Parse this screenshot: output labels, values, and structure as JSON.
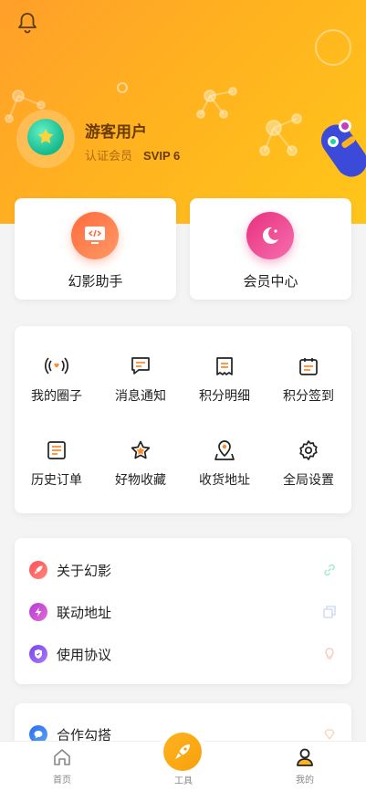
{
  "user": {
    "name": "游客用户",
    "level_label": "认证会员",
    "vip": "SVIP 6"
  },
  "quick_cards": [
    {
      "label": "幻影助手",
      "icon": "monitor-code-icon",
      "color": "#ff7a45"
    },
    {
      "label": "会员中心",
      "icon": "moon-icon",
      "color": "#ee3f8b"
    }
  ],
  "grid": [
    {
      "label": "我的圈子",
      "icon": "broadcast-heart-icon"
    },
    {
      "label": "消息通知",
      "icon": "message-icon"
    },
    {
      "label": "积分明细",
      "icon": "receipt-icon"
    },
    {
      "label": "积分签到",
      "icon": "calendar-icon"
    },
    {
      "label": "历史订单",
      "icon": "order-list-icon"
    },
    {
      "label": "好物收藏",
      "icon": "star-icon"
    },
    {
      "label": "收货地址",
      "icon": "map-pin-icon"
    },
    {
      "label": "全局设置",
      "icon": "gear-icon"
    }
  ],
  "links": [
    {
      "label": "关于幻影",
      "icon": "rocket-icon",
      "color": "#ff5a5f",
      "right_icon": "link-icon"
    },
    {
      "label": "联动地址",
      "icon": "lightning-icon",
      "color": "#c94bd6",
      "right_icon": "copy-icon"
    },
    {
      "label": "使用协议",
      "icon": "shield-icon",
      "color": "#8a52f2",
      "right_icon": "bulb-icon"
    }
  ],
  "partner": {
    "label": "合作勾搭",
    "icon": "chat-bubble-icon",
    "color": "#2e7df6"
  },
  "tabbar": {
    "home": "首页",
    "tools": "工具",
    "mine": "我的"
  },
  "colors": {
    "accent": "#ffb21f",
    "name": "#6a3b00"
  }
}
